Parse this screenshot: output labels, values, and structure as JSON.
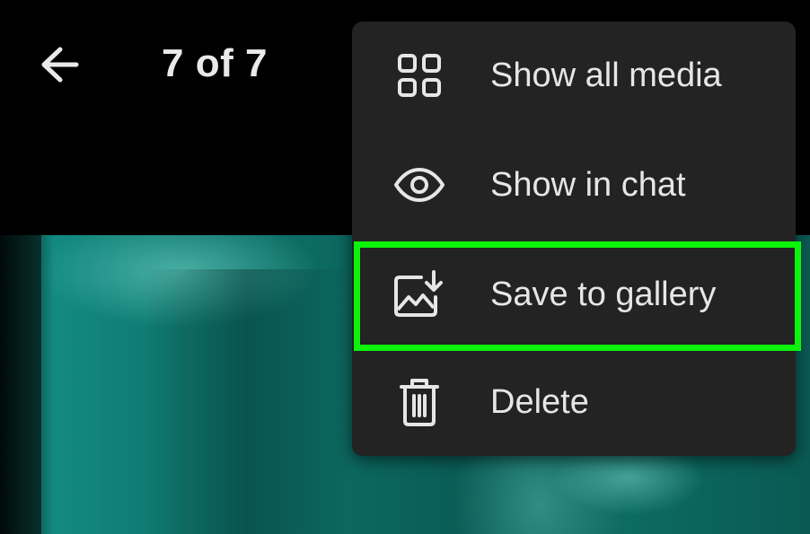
{
  "topbar": {
    "counter": "7 of 7",
    "back_icon": "arrow-left-icon"
  },
  "menu": {
    "items": [
      {
        "label": "Show all media",
        "icon": "grid-icon"
      },
      {
        "label": "Show in chat",
        "icon": "eye-icon"
      },
      {
        "label": "Save to gallery",
        "icon": "image-download-icon",
        "highlighted": true
      },
      {
        "label": "Delete",
        "icon": "trash-icon"
      }
    ]
  },
  "colors": {
    "menu_background": "#232323",
    "highlight_border": "#0cf40c",
    "text": "#e6e6e6",
    "media_teal": "#0f776e"
  }
}
